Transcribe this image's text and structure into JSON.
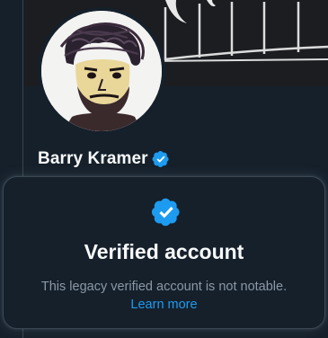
{
  "profile": {
    "display_name": "Barry Kramer",
    "badge_icon": "verified-badge-icon",
    "accent_color": "#1d9bf0"
  },
  "popover": {
    "icon": "verified-badge-icon",
    "title": "Verified account",
    "description": "This legacy verified account is not notable.",
    "link_label": "Learn more"
  },
  "colors": {
    "background": "#15202b",
    "text_primary": "#f7f9f9",
    "text_secondary": "#8b98a5",
    "link": "#1d9bf0"
  }
}
